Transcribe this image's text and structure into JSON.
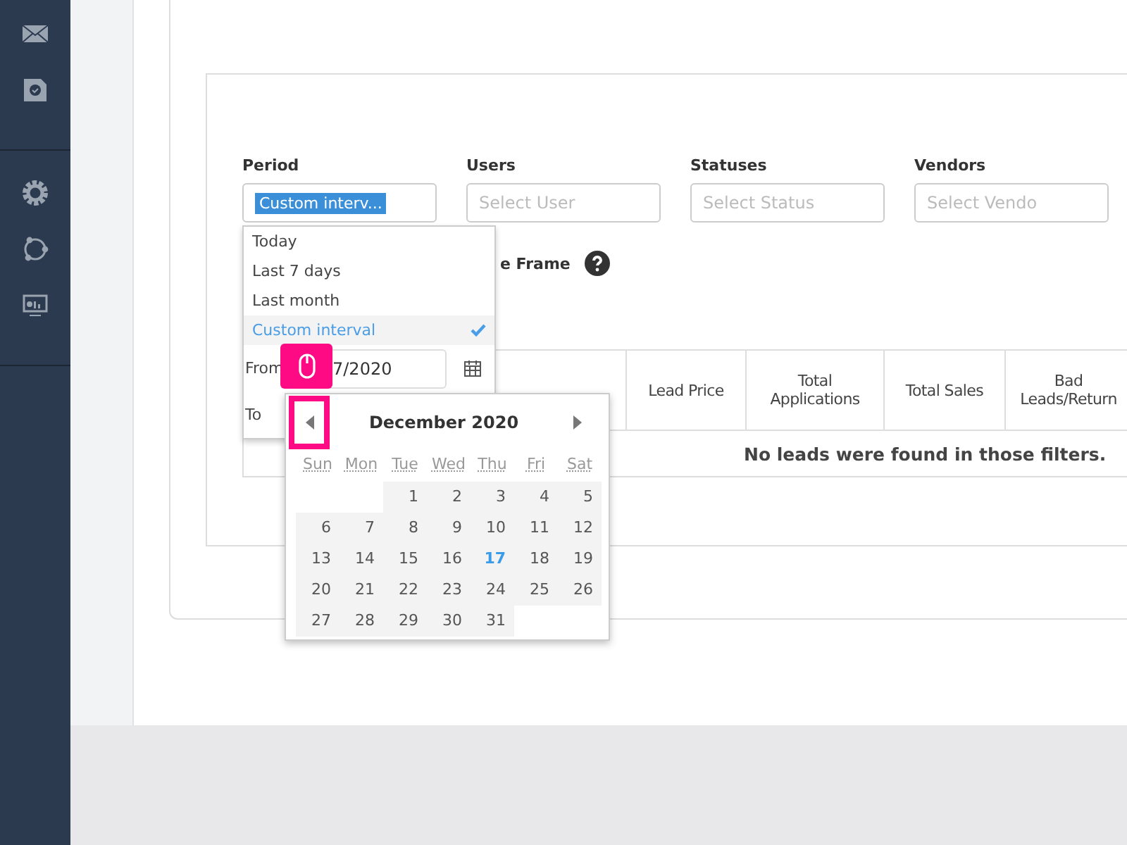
{
  "filters": [
    {
      "label": "Period",
      "value": "Custom interv..."
    },
    {
      "label": "Users",
      "placeholder": "Select User"
    },
    {
      "label": "Statuses",
      "placeholder": "Select Status"
    },
    {
      "label": "Vendors",
      "placeholder": "Select Vendo"
    }
  ],
  "time_frame": {
    "label": "e Frame"
  },
  "period_menu": {
    "options": [
      {
        "label": "Today",
        "selected": false
      },
      {
        "label": "Last 7 days",
        "selected": false
      },
      {
        "label": "Last month",
        "selected": false
      },
      {
        "label": "Custom interval",
        "selected": true
      }
    ],
    "from_label": "From",
    "from_value": "7/2020",
    "to_label": "To"
  },
  "calendar": {
    "month": "December",
    "year": "2020",
    "weekdays": [
      "Sun",
      "Mon",
      "Tue",
      "Wed",
      "Thu",
      "Fri",
      "Sat"
    ],
    "weeks": [
      {
        "days": [
          {
            "d": "1",
            "today": false
          },
          {
            "d": "2",
            "today": false
          },
          {
            "d": "3",
            "today": false
          },
          {
            "d": "4",
            "today": false
          },
          {
            "d": "5",
            "today": false
          }
        ]
      },
      {
        "days": [
          {
            "d": "6",
            "today": false
          },
          {
            "d": "7",
            "today": false
          },
          {
            "d": "8",
            "today": false
          },
          {
            "d": "9",
            "today": false
          },
          {
            "d": "10",
            "today": false
          },
          {
            "d": "11",
            "today": false
          },
          {
            "d": "12",
            "today": false
          }
        ]
      },
      {
        "days": [
          {
            "d": "13",
            "today": false
          },
          {
            "d": "14",
            "today": false
          },
          {
            "d": "15",
            "today": false
          },
          {
            "d": "16",
            "today": false
          },
          {
            "d": "17",
            "today": true
          },
          {
            "d": "18",
            "today": false
          },
          {
            "d": "19",
            "today": false
          }
        ]
      },
      {
        "days": [
          {
            "d": "20",
            "today": false
          },
          {
            "d": "21",
            "today": false
          },
          {
            "d": "22",
            "today": false
          },
          {
            "d": "23",
            "today": false
          },
          {
            "d": "24",
            "today": false
          },
          {
            "d": "25",
            "today": false
          },
          {
            "d": "26",
            "today": false
          }
        ]
      },
      {
        "days": [
          {
            "d": "27",
            "today": false
          },
          {
            "d": "28",
            "today": false
          },
          {
            "d": "29",
            "today": false
          },
          {
            "d": "30",
            "today": false
          },
          {
            "d": "31",
            "today": false
          }
        ]
      }
    ]
  },
  "table": {
    "columns": [
      "Lead Price",
      "Total Applications",
      "Total Sales",
      "Bad Leads/Return"
    ],
    "empty_message": "No leads were found in those filters."
  }
}
